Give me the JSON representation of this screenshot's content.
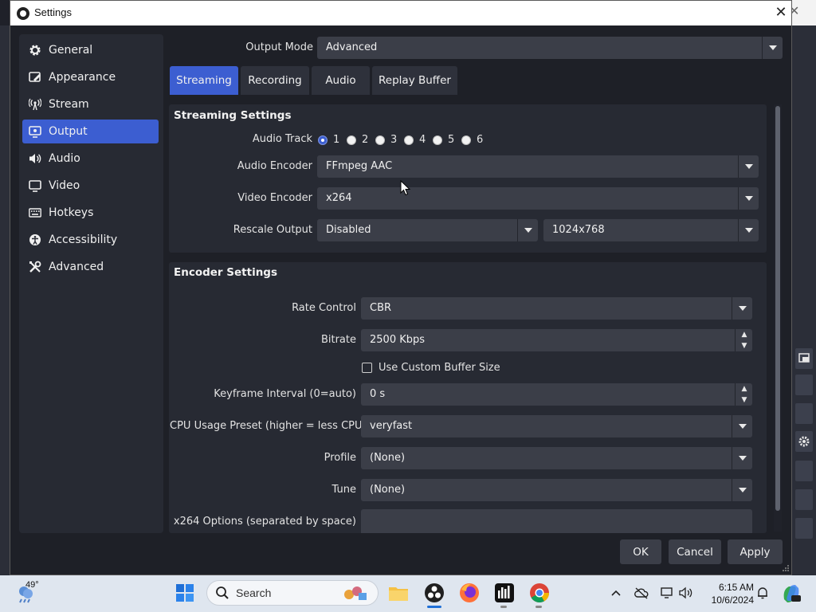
{
  "window": {
    "title": "Settings"
  },
  "sidebar": {
    "items": [
      {
        "label": "General",
        "icon": "gear-icon"
      },
      {
        "label": "Appearance",
        "icon": "appearance-icon"
      },
      {
        "label": "Stream",
        "icon": "antenna-icon"
      },
      {
        "label": "Output",
        "icon": "output-icon",
        "active": true
      },
      {
        "label": "Audio",
        "icon": "speaker-icon"
      },
      {
        "label": "Video",
        "icon": "monitor-icon"
      },
      {
        "label": "Hotkeys",
        "icon": "keyboard-icon"
      },
      {
        "label": "Accessibility",
        "icon": "accessibility-icon"
      },
      {
        "label": "Advanced",
        "icon": "tools-icon"
      }
    ]
  },
  "output_mode": {
    "label": "Output Mode",
    "value": "Advanced"
  },
  "tabs": [
    {
      "label": "Streaming",
      "active": true
    },
    {
      "label": "Recording"
    },
    {
      "label": "Audio"
    },
    {
      "label": "Replay Buffer"
    }
  ],
  "streaming_settings": {
    "title": "Streaming Settings",
    "audio_track": {
      "label": "Audio Track",
      "options": [
        "1",
        "2",
        "3",
        "4",
        "5",
        "6"
      ],
      "selected": "1"
    },
    "audio_encoder": {
      "label": "Audio Encoder",
      "value": "FFmpeg AAC"
    },
    "video_encoder": {
      "label": "Video Encoder",
      "value": "x264"
    },
    "rescale_output": {
      "label": "Rescale Output",
      "value": "Disabled",
      "resolution": "1024x768"
    }
  },
  "encoder_settings": {
    "title": "Encoder Settings",
    "rate_control": {
      "label": "Rate Control",
      "value": "CBR"
    },
    "bitrate": {
      "label": "Bitrate",
      "value": "2500 Kbps"
    },
    "custom_buffer": {
      "label": "Use Custom Buffer Size",
      "checked": false
    },
    "keyframe_interval": {
      "label": "Keyframe Interval (0=auto)",
      "value": "0 s"
    },
    "cpu_preset": {
      "label": "CPU Usage Preset (higher = less CPU)",
      "value": "veryfast"
    },
    "profile": {
      "label": "Profile",
      "value": "(None)"
    },
    "tune": {
      "label": "Tune",
      "value": "(None)"
    },
    "x264_options": {
      "label": "x264 Options (separated by space)",
      "value": ""
    }
  },
  "buttons": {
    "ok": "OK",
    "cancel": "Cancel",
    "apply": "Apply"
  },
  "taskbar": {
    "weather": "49°",
    "search_placeholder": "Search",
    "time": "6:15 AM",
    "date": "10/6/2024",
    "colors": {
      "accent": "#3c5ed1",
      "taskbar_bg": "#dfe6ef"
    }
  }
}
